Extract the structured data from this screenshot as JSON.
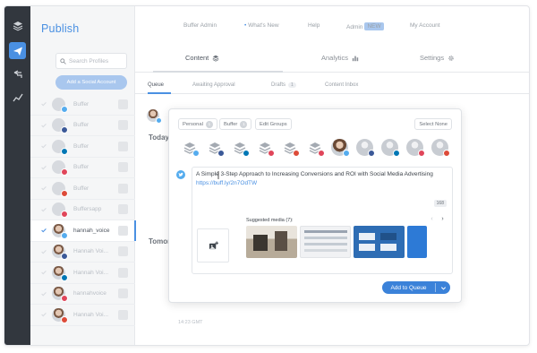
{
  "app": {
    "title": "Publish"
  },
  "rail": {
    "icons": [
      "layers-icon",
      "paper-plane-icon",
      "reply-icon",
      "analytics-icon"
    ]
  },
  "sidebar": {
    "search_placeholder": "Search Profiles",
    "add_button": "Add a Social Account",
    "profiles": [
      {
        "name": "Buffer",
        "network": "twitter",
        "color": "#55acee",
        "selected": false,
        "photo": false
      },
      {
        "name": "Buffer",
        "network": "facebook",
        "color": "#3b5998",
        "selected": false,
        "photo": false
      },
      {
        "name": "Buffer",
        "network": "linkedin",
        "color": "#0077b5",
        "selected": false,
        "photo": false
      },
      {
        "name": "Buffer",
        "network": "pinterest",
        "color": "#e0465a",
        "selected": false,
        "photo": false
      },
      {
        "name": "Buffer",
        "network": "google",
        "color": "#dd4b39",
        "selected": false,
        "photo": false
      },
      {
        "name": "Buffersapp",
        "network": "pinterest",
        "color": "#e0465a",
        "selected": false,
        "photo": false
      },
      {
        "name": "hannah_voice",
        "network": "twitter",
        "color": "#55acee",
        "selected": true,
        "photo": true
      },
      {
        "name": "Hannah Voi...",
        "network": "facebook",
        "color": "#3b5998",
        "selected": false,
        "photo": true
      },
      {
        "name": "Hannah Voi...",
        "network": "linkedin",
        "color": "#0077b5",
        "selected": false,
        "photo": true
      },
      {
        "name": "hannahvoice",
        "network": "pinterest",
        "color": "#e0465a",
        "selected": false,
        "photo": true
      },
      {
        "name": "Hannah Voi...",
        "network": "google",
        "color": "#dd4b39",
        "selected": false,
        "photo": true
      }
    ]
  },
  "topnav": {
    "buffer_admin": "Buffer Admin",
    "whats_new": "What's New",
    "help": "Help",
    "admin": "Admin",
    "admin_badge": "NEW",
    "my_account": "My Account"
  },
  "main_tabs": {
    "content": "Content",
    "analytics": "Analytics",
    "settings": "Settings"
  },
  "sub_tabs": {
    "queue": "Queue",
    "awaiting": "Awaiting Approval",
    "drafts": "Drafts",
    "drafts_count": "1",
    "content_inbox": "Content Inbox"
  },
  "queue": {
    "today": "Today",
    "tomorrow": "Tomor",
    "footer_time": "14:23 GMT"
  },
  "composer": {
    "group_personal": "Personal",
    "group_personal_count": "1",
    "group_buffer": "Buffer",
    "group_buffer_count": "1",
    "edit_groups": "Edit Groups",
    "select_none": "Select None",
    "post_text": "A Simple 3-Step Approach to Increasing Conversions and ROI with Social Media Advertising",
    "post_link": "https://buff.ly/2n7OdTW",
    "char_count": "168",
    "suggested_label": "Suggested media (7):",
    "add_to_queue": "Add to Queue",
    "strip": [
      {
        "kind": "layer",
        "net": "#55acee"
      },
      {
        "kind": "layer",
        "net": "#3b5998"
      },
      {
        "kind": "layer",
        "net": "#0077b5"
      },
      {
        "kind": "layer",
        "net": "#e0465a"
      },
      {
        "kind": "layer",
        "net": "#dd4b39"
      },
      {
        "kind": "layer",
        "net": "#e0465a"
      },
      {
        "kind": "me",
        "net": "#55acee"
      },
      {
        "kind": "person",
        "net": "#3b5998"
      },
      {
        "kind": "person",
        "net": "#0077b5"
      },
      {
        "kind": "person",
        "net": "#e0465a"
      },
      {
        "kind": "person",
        "net": "#dd4b39"
      }
    ]
  },
  "colors": {
    "accent": "#4a90e2",
    "rail": "#32373e",
    "twitter": "#55acee"
  }
}
